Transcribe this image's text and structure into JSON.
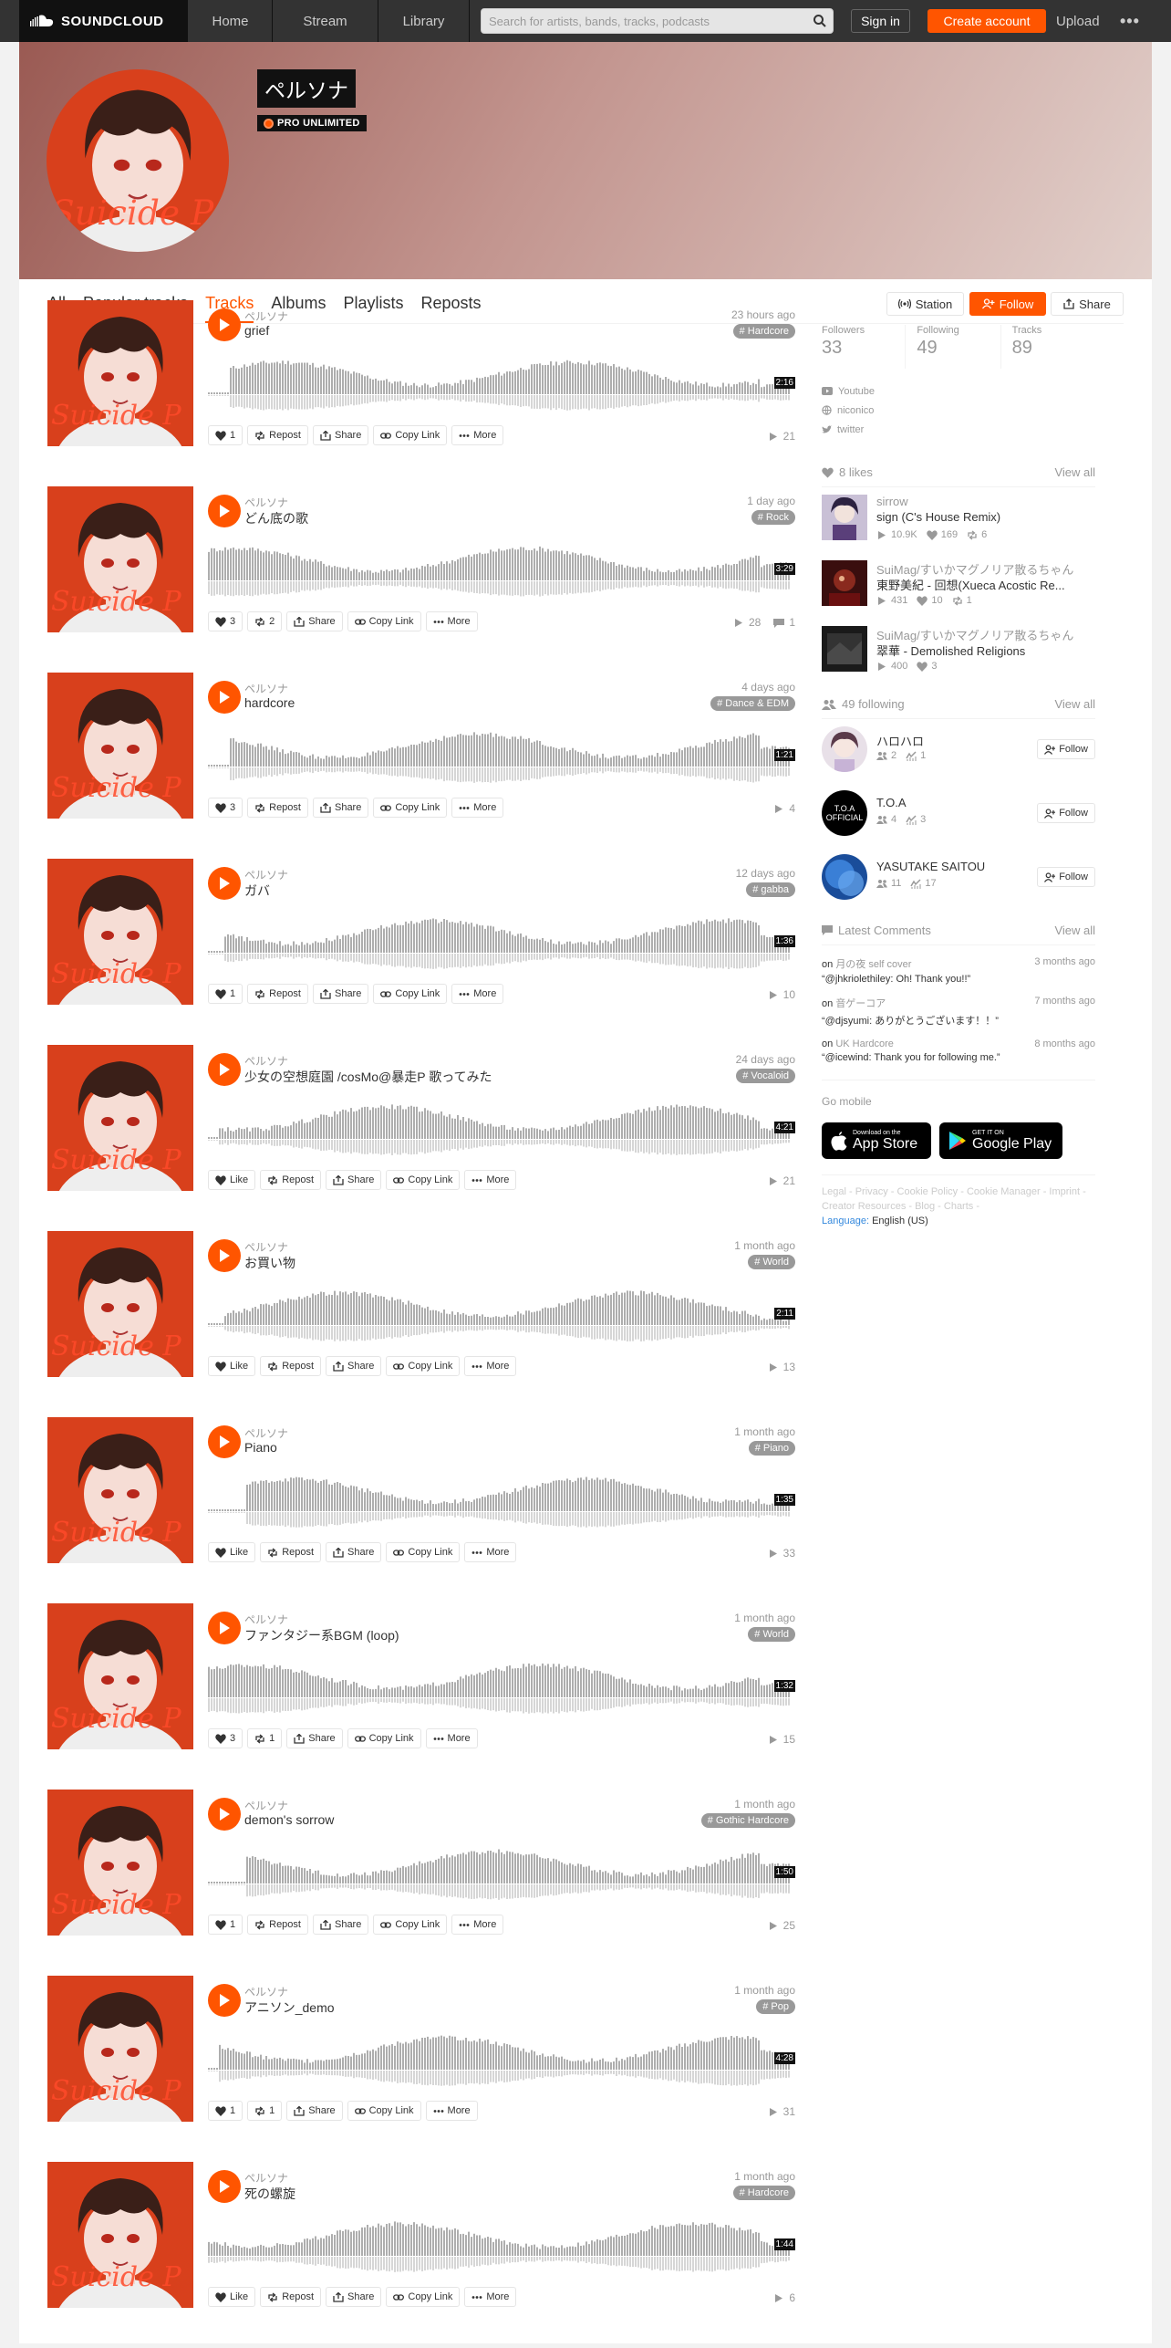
{
  "topbar": {
    "logo_text": "SOUNDCLOUD",
    "nav": [
      "Home",
      "Stream",
      "Library"
    ],
    "search_placeholder": "Search for artists, bands, tracks, podcasts",
    "signin": "Sign in",
    "create": "Create account",
    "upload": "Upload",
    "more": "•••"
  },
  "profile": {
    "name": "ペルソナ",
    "badge": "PRO UNLIMITED"
  },
  "tabs": [
    "All",
    "Popular tracks",
    "Tracks",
    "Albums",
    "Playlists",
    "Reposts"
  ],
  "active_tab": "Tracks",
  "header_buttons": {
    "station": "Station",
    "follow": "Follow",
    "share": "Share"
  },
  "action_labels": {
    "repost": "Repost",
    "share": "Share",
    "copy": "Copy Link",
    "more": "More"
  },
  "tracks": [
    {
      "user": "ペルソナ",
      "title": "grief",
      "date": "23 hours ago",
      "tag": "# Hardcore",
      "duration": "2:16",
      "like": "1",
      "repost": "",
      "plays": "21",
      "comments": ""
    },
    {
      "user": "ペルソナ",
      "title": "どん底の歌",
      "date": "1 day ago",
      "tag": "# Rock",
      "duration": "3:29",
      "like": "3",
      "repost": "2",
      "plays": "28",
      "comments": "1"
    },
    {
      "user": "ペルソナ",
      "title": "hardcore",
      "date": "4 days ago",
      "tag": "# Dance & EDM",
      "duration": "1:21",
      "like": "3",
      "repost": "",
      "plays": "4",
      "comments": ""
    },
    {
      "user": "ペルソナ",
      "title": "ガバ",
      "date": "12 days ago",
      "tag": "# gabba",
      "duration": "1:36",
      "like": "1",
      "repost": "",
      "plays": "10",
      "comments": ""
    },
    {
      "user": "ペルソナ",
      "title": "少女の空想庭園 /cosMo@暴走P 歌ってみた",
      "date": "24 days ago",
      "tag": "# Vocaloid",
      "duration": "4:21",
      "like": "Like",
      "repost": "",
      "plays": "21",
      "comments": ""
    },
    {
      "user": "ペルソナ",
      "title": "お買い物",
      "date": "1 month ago",
      "tag": "# World",
      "duration": "2:11",
      "like": "Like",
      "repost": "",
      "plays": "13",
      "comments": ""
    },
    {
      "user": "ペルソナ",
      "title": "Piano",
      "date": "1 month ago",
      "tag": "# Piano",
      "duration": "1:35",
      "like": "Like",
      "repost": "",
      "plays": "33",
      "comments": ""
    },
    {
      "user": "ペルソナ",
      "title": "ファンタジー系BGM (loop)",
      "date": "1 month ago",
      "tag": "# World",
      "duration": "1:32",
      "like": "3",
      "repost": "1",
      "plays": "15",
      "comments": ""
    },
    {
      "user": "ペルソナ",
      "title": "demon's sorrow",
      "date": "1 month ago",
      "tag": "# Gothic Hardcore",
      "duration": "1:50",
      "like": "1",
      "repost": "",
      "plays": "25",
      "comments": ""
    },
    {
      "user": "ペルソナ",
      "title": "アニソン_demo",
      "date": "1 month ago",
      "tag": "# Pop",
      "duration": "4:28",
      "like": "1",
      "repost": "1",
      "plays": "31",
      "comments": ""
    },
    {
      "user": "ペルソナ",
      "title": "死の螺旋",
      "date": "1 month ago",
      "tag": "# Hardcore",
      "duration": "1:44",
      "like": "Like",
      "repost": "",
      "plays": "6",
      "comments": ""
    }
  ],
  "stats": [
    {
      "label": "Followers",
      "value": "33"
    },
    {
      "label": "Following",
      "value": "49"
    },
    {
      "label": "Tracks",
      "value": "89"
    }
  ],
  "links": [
    "Youtube",
    "niconico",
    "twitter"
  ],
  "likes": {
    "header": "8 likes",
    "view_all": "View all",
    "items": [
      {
        "user": "sirrow",
        "title": "sign (C's House Remix)",
        "plays": "10.9K",
        "likes": "169",
        "reposts": "6"
      },
      {
        "user": "SuiMag/すいかマグノリア散るちゃん",
        "title": "東野美紀 - 回想(Xueca Acostic Re...",
        "plays": "431",
        "likes": "10",
        "reposts": "1"
      },
      {
        "user": "SuiMag/すいかマグノリア散るちゃん",
        "title": "翠華 - Demolished Religions",
        "plays": "400",
        "likes": "3",
        "reposts": ""
      }
    ]
  },
  "following": {
    "header": "49 following",
    "view_all": "View all",
    "follow_label": "Follow",
    "items": [
      {
        "name": "ハロハロ",
        "followers": "2",
        "tracks": "1"
      },
      {
        "name": "T.O.A",
        "followers": "4",
        "tracks": "3",
        "logo_text": "T.O.A OFFICIAL"
      },
      {
        "name": "YASUTAKE SAITOU",
        "followers": "11",
        "tracks": "17"
      }
    ]
  },
  "comments": {
    "header": "Latest Comments",
    "view_all": "View all",
    "on": "on",
    "items": [
      {
        "track": "月の夜 self cover",
        "time": "3 months ago",
        "text": "“@jhkriolethiley: Oh! Thank you!!”"
      },
      {
        "track": "音ゲーコア",
        "time": "7 months ago",
        "text": "“@djsyumi: ありがとうございます！！”"
      },
      {
        "track": "UK Hardcore",
        "time": "8 months ago",
        "text": "“@icewind: Thank you for following me.”"
      }
    ]
  },
  "go_mobile": "Go mobile",
  "app_store": {
    "small": "Download on the",
    "big": "App Store"
  },
  "google_play": {
    "small": "GET IT ON",
    "big": "Google Play"
  },
  "footer_links": "Legal - Privacy - Cookie Policy - Cookie Manager - Imprint - Creator Resources - Blog - Charts -",
  "language_label": "Language:",
  "language_value": "English (US)",
  "colors": {
    "accent": "#ff5500",
    "topbar": "#333333"
  }
}
